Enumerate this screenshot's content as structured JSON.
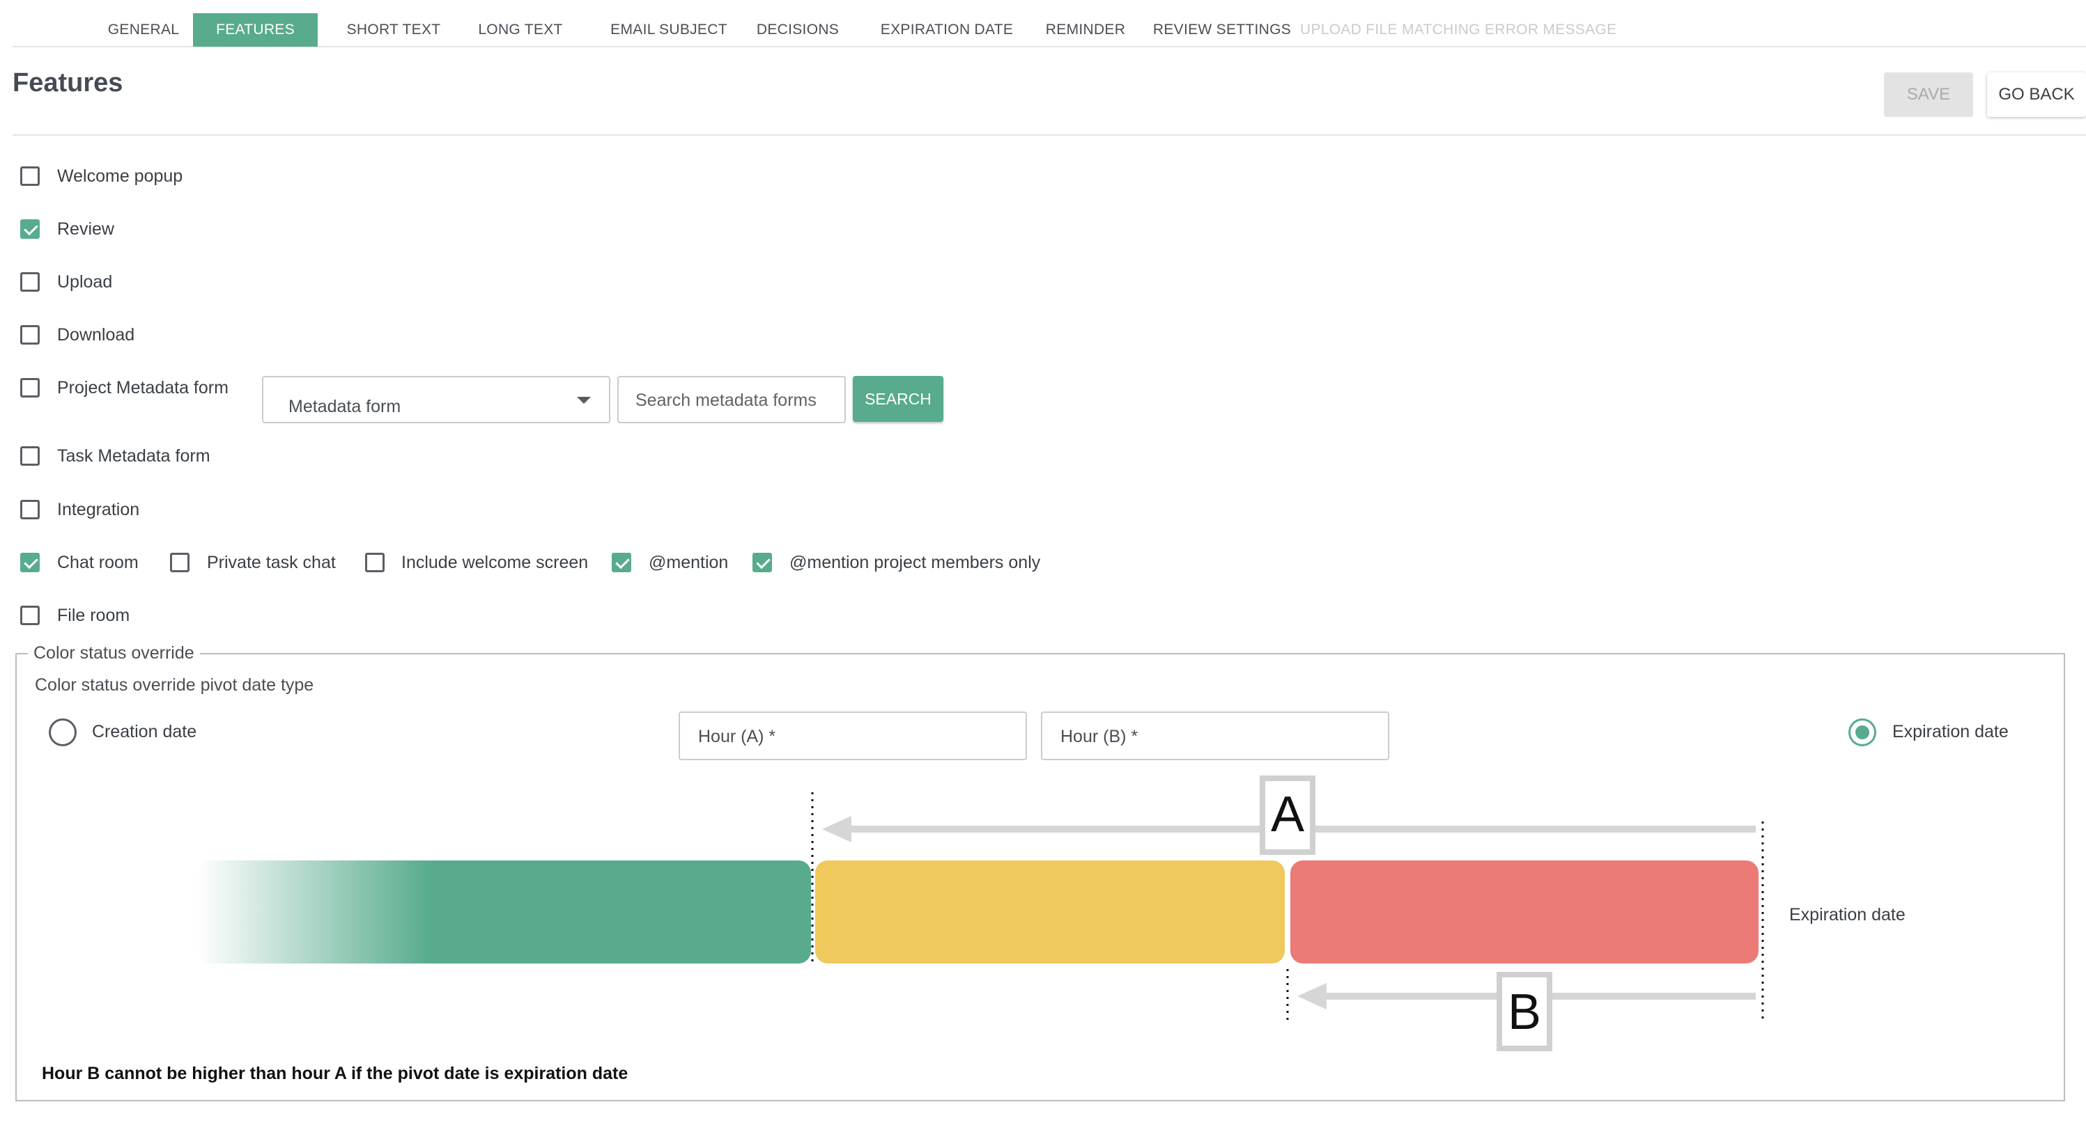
{
  "tabs": [
    {
      "label": "GENERAL",
      "active": false,
      "disabled": false
    },
    {
      "label": "FEATURES",
      "active": true,
      "disabled": false
    },
    {
      "label": "SHORT TEXT",
      "active": false,
      "disabled": false
    },
    {
      "label": "LONG TEXT",
      "active": false,
      "disabled": false
    },
    {
      "label": "EMAIL SUBJECT",
      "active": false,
      "disabled": false
    },
    {
      "label": "DECISIONS",
      "active": false,
      "disabled": false
    },
    {
      "label": "EXPIRATION DATE",
      "active": false,
      "disabled": false
    },
    {
      "label": "REMINDER",
      "active": false,
      "disabled": false
    },
    {
      "label": "REVIEW SETTINGS",
      "active": false,
      "disabled": false
    },
    {
      "label": "UPLOAD FILE MATCHING ERROR MESSAGE",
      "active": false,
      "disabled": true
    }
  ],
  "header": {
    "title": "Features",
    "save_label": "SAVE",
    "save_disabled": true,
    "back_label": "GO BACK"
  },
  "features": {
    "welcome_popup": {
      "label": "Welcome popup",
      "checked": false
    },
    "review": {
      "label": "Review",
      "checked": true
    },
    "upload": {
      "label": "Upload",
      "checked": false
    },
    "download": {
      "label": "Download",
      "checked": false
    },
    "project_metadata": {
      "label": "Project Metadata form",
      "checked": false
    },
    "task_metadata": {
      "label": "Task Metadata form",
      "checked": false
    },
    "integration": {
      "label": "Integration",
      "checked": false
    },
    "chat_room": {
      "label": "Chat room",
      "checked": true
    },
    "private_task_chat": {
      "label": "Private task chat",
      "checked": false
    },
    "include_welcome": {
      "label": "Include welcome screen",
      "checked": false
    },
    "mention": {
      "label": "@mention",
      "checked": true
    },
    "mention_members": {
      "label": "@mention project members only",
      "checked": true
    },
    "file_room": {
      "label": "File room",
      "checked": false
    }
  },
  "metadata": {
    "select_value": "Metadata form",
    "search_placeholder": "Search metadata forms",
    "search_label": "SEARCH"
  },
  "color_status": {
    "legend": "Color status override",
    "pivot_label": "Color status override pivot date type",
    "creation_label": "Creation date",
    "creation_selected": false,
    "expiration_label": "Expiration date",
    "expiration_selected": true,
    "hour_a_label": "Hour (A) *",
    "hour_b_label": "Hour (B) *",
    "diagram_end_label": "Expiration date",
    "marker_a": "A",
    "marker_b": "B",
    "note": "Hour B cannot be higher than hour A if the pivot date is expiration date",
    "colors": {
      "green": "#58ab8d",
      "yellow": "#f0c95c",
      "red": "#ec7a76"
    }
  }
}
